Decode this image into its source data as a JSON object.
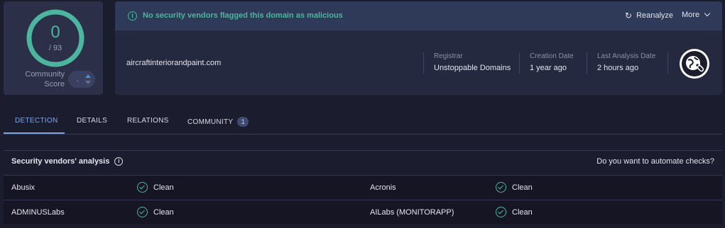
{
  "score": {
    "detections": "0",
    "total": "/ 93",
    "community_label": "Community Score",
    "vote_value": "-"
  },
  "banner": {
    "message": "No security vendors flagged this domain as malicious",
    "reanalyze_label": "Reanalyze",
    "more_label": "More"
  },
  "domain": {
    "name": "aircraftinteriorandpaint.com",
    "registrar_label": "Registrar",
    "registrar_value": "Unstoppable Domains",
    "creation_label": "Creation Date",
    "creation_value": "1 year ago",
    "analysis_label": "Last Analysis Date",
    "analysis_value": "2 hours ago"
  },
  "tabs": [
    {
      "label": "DETECTION"
    },
    {
      "label": "DETAILS"
    },
    {
      "label": "RELATIONS"
    },
    {
      "label": "COMMUNITY",
      "badge": "1"
    }
  ],
  "analysis": {
    "title": "Security vendors' analysis",
    "automate_link": "Do you want to automate checks?",
    "rows": [
      {
        "left_vendor": "Abusix",
        "left_result": "Clean",
        "right_vendor": "Acronis",
        "right_result": "Clean"
      },
      {
        "left_vendor": "ADMINUSLabs",
        "left_result": "Clean",
        "right_vendor": "AILabs (MONITORAPP)",
        "right_result": "Clean"
      }
    ]
  },
  "colors": {
    "accent_green": "#4bb59f",
    "tab_active": "#7ea6e6",
    "background": "#1b1c2e"
  },
  "icons": [
    "info-icon",
    "reanalyze-icon",
    "chevron-down-icon",
    "domain-badge-icon",
    "check-circle-icon"
  ]
}
